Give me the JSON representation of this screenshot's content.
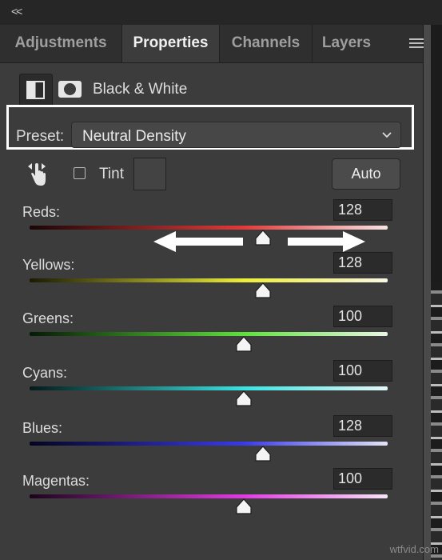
{
  "topbar": {
    "collapse_icon": "<<"
  },
  "tabs": [
    {
      "label": "Adjustments",
      "active": false
    },
    {
      "label": "Properties",
      "active": true
    },
    {
      "label": "Channels",
      "active": false
    },
    {
      "label": "Layers",
      "active": false
    }
  ],
  "panel": {
    "title": "Black & White",
    "preset": {
      "label": "Preset:",
      "value": "Neutral Density"
    },
    "tint_label": "Tint",
    "tint_checked": false,
    "auto_label": "Auto"
  },
  "sliders": [
    {
      "id": "reds",
      "label": "Reds:",
      "value": "128",
      "position": 0.652,
      "gradient": [
        "#1a0505",
        "#e23a3a",
        "#f7e3e3"
      ]
    },
    {
      "id": "yellows",
      "label": "Yellows:",
      "value": "128",
      "position": 0.652,
      "gradient": [
        "#1a1a04",
        "#eded3a",
        "#f7f7e3"
      ]
    },
    {
      "id": "greens",
      "label": "Greens:",
      "value": "100",
      "position": 0.598,
      "gradient": [
        "#041a04",
        "#5ee23a",
        "#e8f7e3"
      ]
    },
    {
      "id": "cyans",
      "label": "Cyans:",
      "value": "100",
      "position": 0.598,
      "gradient": [
        "#041a1a",
        "#3ae2e2",
        "#e3f7f7"
      ]
    },
    {
      "id": "blues",
      "label": "Blues:",
      "value": "128",
      "position": 0.652,
      "gradient": [
        "#040420",
        "#3a3ae8",
        "#e3e3f7"
      ]
    },
    {
      "id": "magentas",
      "label": "Magentas:",
      "value": "100",
      "position": 0.598,
      "gradient": [
        "#1a041a",
        "#e23ae2",
        "#f7e3f7"
      ]
    }
  ],
  "watermark": "wtfvid.com"
}
